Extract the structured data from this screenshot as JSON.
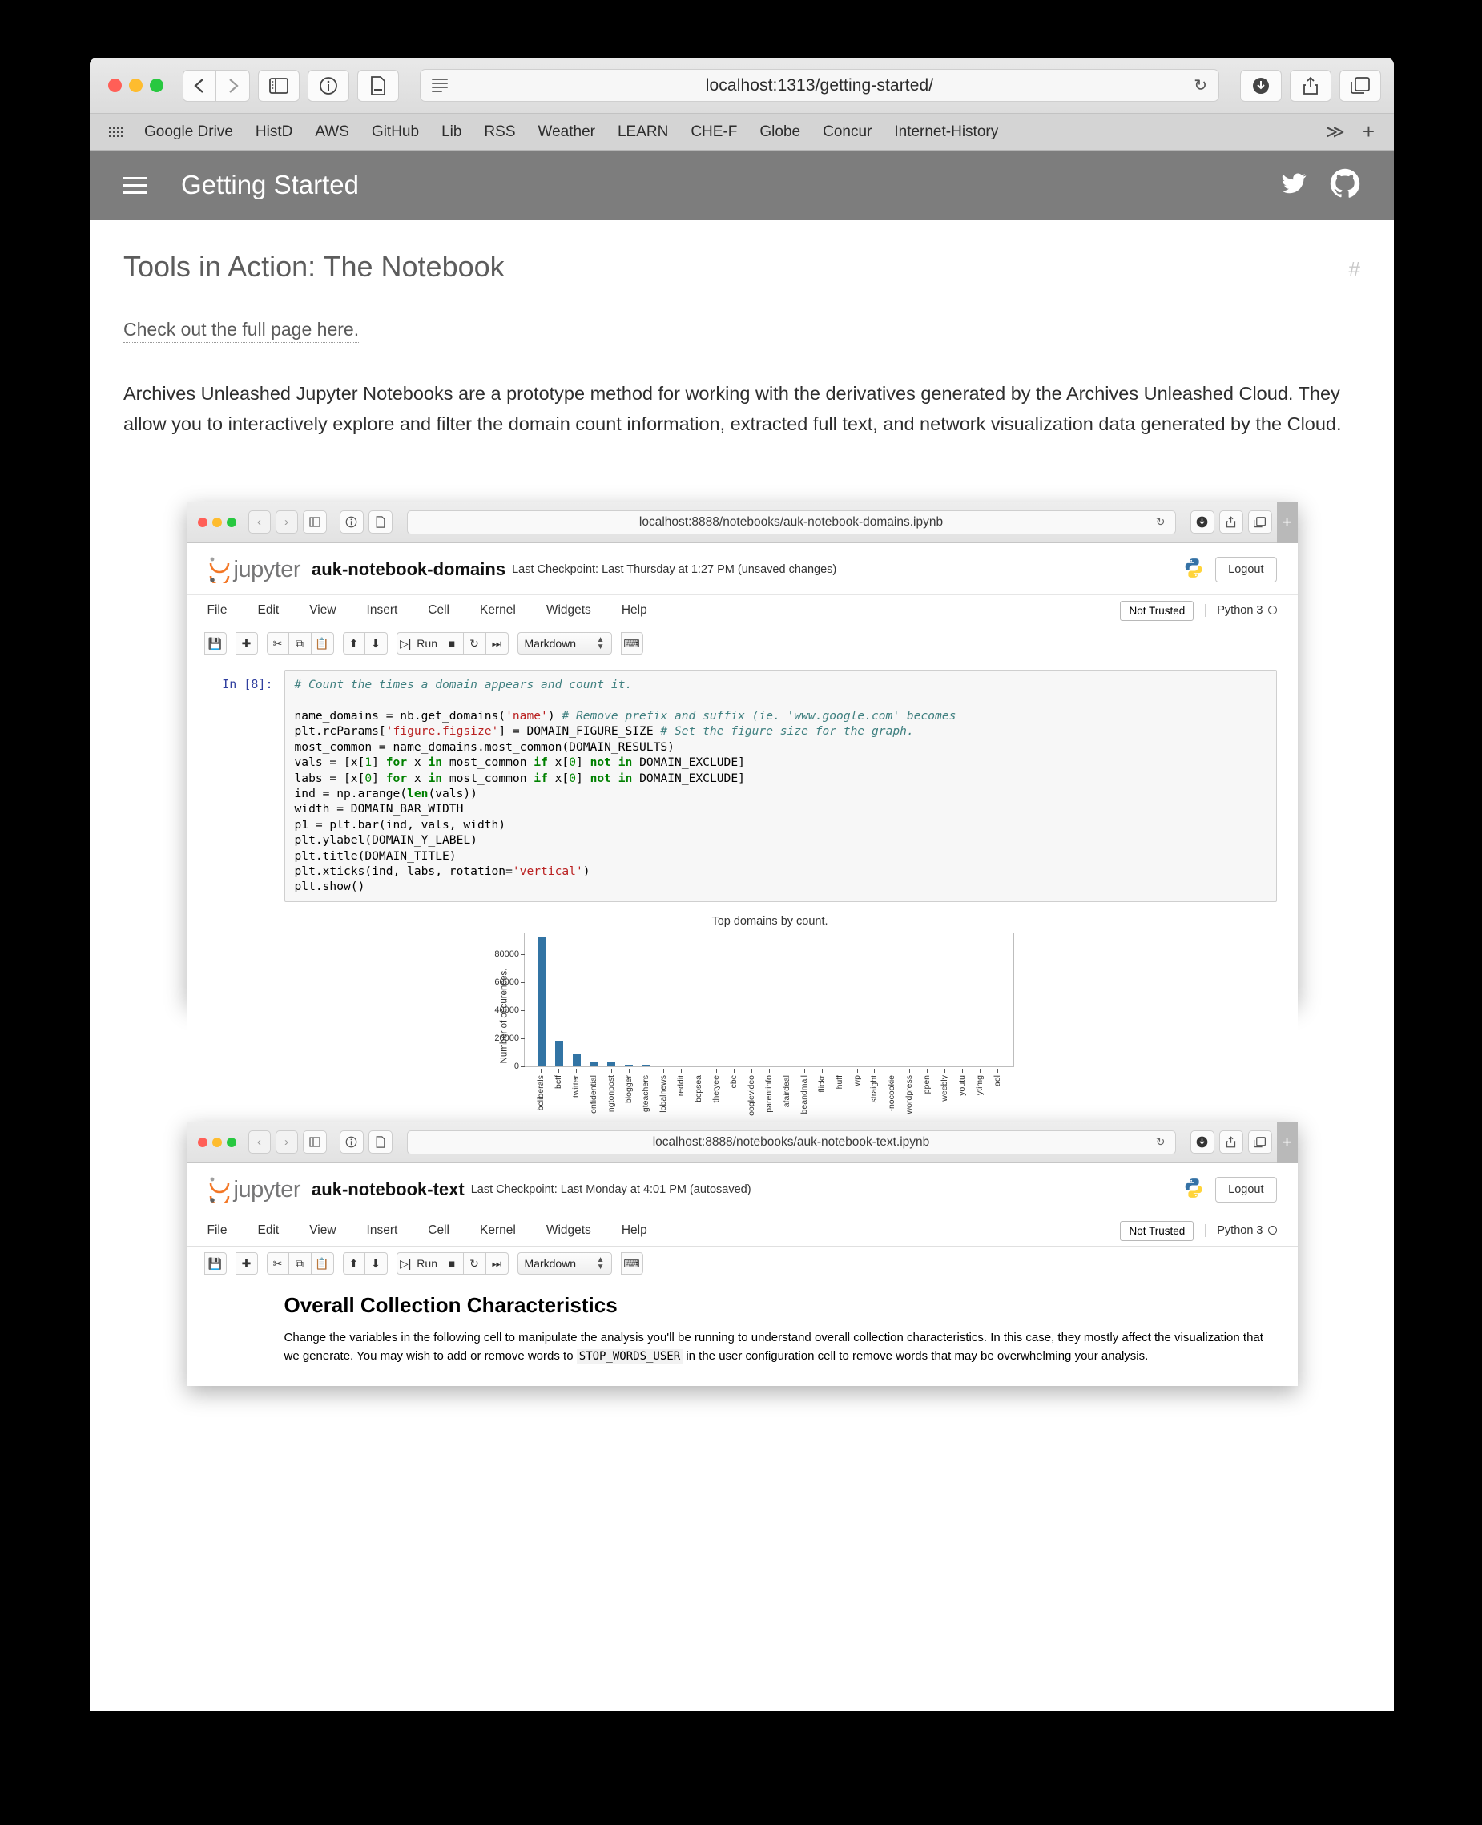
{
  "browser": {
    "url": "localhost:1313/getting-started/",
    "bookmarks": [
      "Google Drive",
      "HistD",
      "AWS",
      "GitHub",
      "Lib",
      "RSS",
      "Weather",
      "LEARN",
      "CHE-F",
      "Globe",
      "Concur",
      "Internet-History"
    ],
    "more_label": "≫",
    "plus_label": "+",
    "reload_label": "↻"
  },
  "site": {
    "title": "Getting Started",
    "heading": "Tools in Action: The Notebook",
    "anchor": "#",
    "link": "Check out the full page here.",
    "paragraph": "Archives Unleashed Jupyter Notebooks are a prototype method for working with the derivatives generated by the Archives Unleashed Cloud. They allow you to interactively explore and filter the domain count information, extracted full text, and network visualization data generated by the Cloud."
  },
  "notebook1": {
    "url": "localhost:8888/notebooks/auk-notebook-domains.ipynb",
    "reload_label": "↻",
    "plus_label": "+",
    "brand": "jupyter",
    "name": "auk-notebook-domains",
    "checkpoint": "Last Checkpoint: Last Thursday at 1:27 PM   (unsaved changes)",
    "logout": "Logout",
    "menu": [
      "File",
      "Edit",
      "View",
      "Insert",
      "Cell",
      "Kernel",
      "Widgets",
      "Help"
    ],
    "trust": "Not Trusted",
    "kernel": "Python 3",
    "run_label": "Run",
    "celltype": "Markdown",
    "prompt": "In [8]:",
    "code_lines": [
      {
        "parts": [
          {
            "t": "# Count the times a domain appears and count it.",
            "c": "c-com"
          }
        ]
      },
      {
        "parts": [
          {
            "t": "",
            "c": ""
          }
        ]
      },
      {
        "parts": [
          {
            "t": "name_domains = nb.get_domains(",
            "c": ""
          },
          {
            "t": "'name'",
            "c": "c-str"
          },
          {
            "t": ") ",
            "c": ""
          },
          {
            "t": "# Remove prefix and suffix (ie. 'www.google.com' becomes",
            "c": "c-com"
          }
        ]
      },
      {
        "parts": [
          {
            "t": "plt.rcParams[",
            "c": ""
          },
          {
            "t": "'figure.figsize'",
            "c": "c-str"
          },
          {
            "t": "] = DOMAIN_FIGURE_SIZE ",
            "c": ""
          },
          {
            "t": "# Set the figure size for the graph.",
            "c": "c-com"
          }
        ]
      },
      {
        "parts": [
          {
            "t": "most_common = name_domains.most_common(DOMAIN_RESULTS)",
            "c": ""
          }
        ]
      },
      {
        "parts": [
          {
            "t": "vals = [x[",
            "c": ""
          },
          {
            "t": "1",
            "c": "c-num"
          },
          {
            "t": "] ",
            "c": ""
          },
          {
            "t": "for",
            "c": "c-kw"
          },
          {
            "t": " x ",
            "c": ""
          },
          {
            "t": "in",
            "c": "c-kw"
          },
          {
            "t": " most_common ",
            "c": ""
          },
          {
            "t": "if",
            "c": "c-kw"
          },
          {
            "t": " x[",
            "c": ""
          },
          {
            "t": "0",
            "c": "c-num"
          },
          {
            "t": "] ",
            "c": ""
          },
          {
            "t": "not in",
            "c": "c-kw"
          },
          {
            "t": " DOMAIN_EXCLUDE]",
            "c": ""
          }
        ]
      },
      {
        "parts": [
          {
            "t": "labs = [x[",
            "c": ""
          },
          {
            "t": "0",
            "c": "c-num"
          },
          {
            "t": "] ",
            "c": ""
          },
          {
            "t": "for",
            "c": "c-kw"
          },
          {
            "t": " x ",
            "c": ""
          },
          {
            "t": "in",
            "c": "c-kw"
          },
          {
            "t": " most_common ",
            "c": ""
          },
          {
            "t": "if",
            "c": "c-kw"
          },
          {
            "t": " x[",
            "c": ""
          },
          {
            "t": "0",
            "c": "c-num"
          },
          {
            "t": "] ",
            "c": ""
          },
          {
            "t": "not in",
            "c": "c-kw"
          },
          {
            "t": " DOMAIN_EXCLUDE]",
            "c": ""
          }
        ]
      },
      {
        "parts": [
          {
            "t": "ind = np.arange(",
            "c": ""
          },
          {
            "t": "len",
            "c": "c-kw"
          },
          {
            "t": "(vals))",
            "c": ""
          }
        ]
      },
      {
        "parts": [
          {
            "t": "width = DOMAIN_BAR_WIDTH",
            "c": ""
          }
        ]
      },
      {
        "parts": [
          {
            "t": "p1 = plt.bar(ind, vals, width)",
            "c": ""
          }
        ]
      },
      {
        "parts": [
          {
            "t": "plt.ylabel(DOMAIN_Y_LABEL)",
            "c": ""
          }
        ]
      },
      {
        "parts": [
          {
            "t": "plt.title(DOMAIN_TITLE)",
            "c": ""
          }
        ]
      },
      {
        "parts": [
          {
            "t": "plt.xticks(ind, labs, rotation=",
            "c": ""
          },
          {
            "t": "'vertical'",
            "c": "c-str"
          },
          {
            "t": ")",
            "c": ""
          }
        ]
      },
      {
        "parts": [
          {
            "t": "plt.show()",
            "c": ""
          }
        ]
      }
    ]
  },
  "notebook2": {
    "url": "localhost:8888/notebooks/auk-notebook-text.ipynb",
    "reload_label": "↻",
    "plus_label": "+",
    "brand": "jupyter",
    "name": "auk-notebook-text",
    "checkpoint": "Last Checkpoint: Last Monday at 4:01 PM   (autosaved)",
    "logout": "Logout",
    "menu": [
      "File",
      "Edit",
      "View",
      "Insert",
      "Cell",
      "Kernel",
      "Widgets",
      "Help"
    ],
    "trust": "Not Trusted",
    "kernel": "Python 3",
    "run_label": "Run",
    "celltype": "Markdown",
    "md_heading": "Overall Collection Characteristics",
    "md_para_1": "Change the variables in the following cell to manipulate the analysis you'll be running to understand overall collection characteristics. In this case, they mostly affect the visualization that we generate. You may wish to add or remove words to",
    "md_code": "STOP_WORDS_USER",
    "md_para_2": "in the user configuration cell to remove words that may be overwhelming your analysis."
  },
  "chart_data": {
    "type": "bar",
    "title": "Top domains by count.",
    "xlabel": "",
    "ylabel": "Number of occurences.",
    "ylim": [
      0,
      95000
    ],
    "yticks": [
      0,
      20000,
      40000,
      60000,
      80000
    ],
    "grid": false,
    "legend": false,
    "categories": [
      "bcliberals",
      "bctf",
      "twitter",
      "onfidential",
      "ngtonpost",
      "blogger",
      "gteachers",
      "lobalnews",
      "reddit",
      "bcpsea",
      "thetyee",
      "cbc",
      "ooglevideo",
      "parentinfo",
      "afairdeal",
      "beandmail",
      "flickr",
      "huff",
      "wp",
      "straight",
      "-nocookie",
      "wordpress",
      "ppen",
      "weebly",
      "youtu",
      "ytimg",
      "aol"
    ],
    "values": [
      92000,
      17500,
      8600,
      3100,
      2500,
      1100,
      1050,
      600,
      600,
      330,
      300,
      300,
      330,
      300,
      300,
      300,
      300,
      300,
      300,
      300,
      300,
      300,
      300,
      300,
      300,
      300,
      300
    ]
  }
}
